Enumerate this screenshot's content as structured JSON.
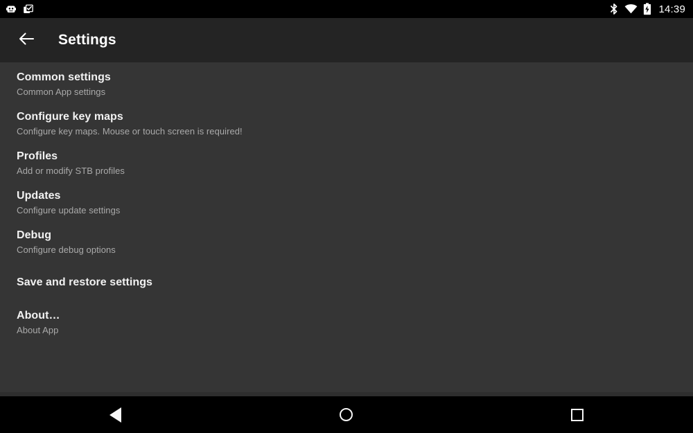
{
  "status_bar": {
    "left_icons": [
      {
        "name": "robot-notification-icon",
        "label": "App notification"
      },
      {
        "name": "clipboard-check-icon",
        "label": "Clipboard notification"
      }
    ],
    "right_icons": [
      {
        "name": "bluetooth-icon",
        "label": "Bluetooth"
      },
      {
        "name": "wifi-icon",
        "label": "Wi-Fi"
      },
      {
        "name": "battery-charging-icon",
        "label": "Battery charging"
      }
    ],
    "clock": "14:39"
  },
  "toolbar": {
    "back_label": "Back",
    "title": "Settings"
  },
  "settings": {
    "items": [
      {
        "title": "Common settings",
        "subtitle": "Common App settings"
      },
      {
        "title": "Configure key maps",
        "subtitle": "Configure key maps. Mouse or touch screen is required!"
      },
      {
        "title": "Profiles",
        "subtitle": "Add or modify STB profiles"
      },
      {
        "title": "Updates",
        "subtitle": "Configure update settings"
      },
      {
        "title": "Debug",
        "subtitle": "Configure debug options"
      },
      {
        "title": "Save and restore settings",
        "subtitle": ""
      },
      {
        "title": "About…",
        "subtitle": "About App"
      }
    ]
  },
  "nav_bar": {
    "back_label": "Back",
    "home_label": "Home",
    "recents_label": "Recent apps"
  },
  "colors": {
    "status_bar_bg": "#000000",
    "toolbar_bg": "#242424",
    "content_bg": "#353535",
    "nav_bar_bg": "#000000",
    "title_text": "#f2f2f2",
    "subtitle_text": "#aaaaaa"
  }
}
